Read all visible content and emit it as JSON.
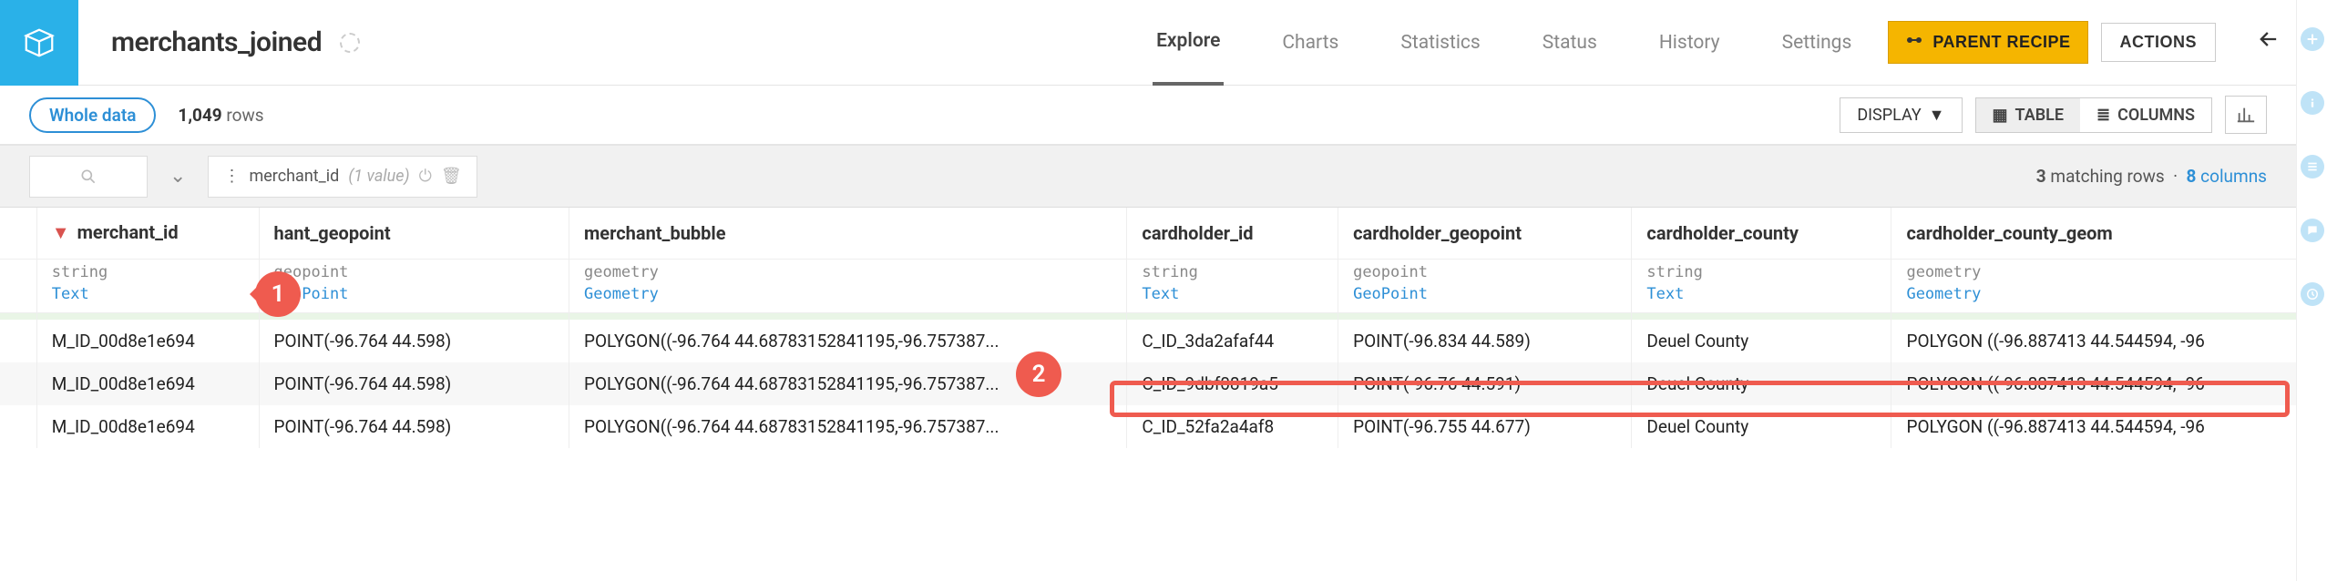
{
  "header": {
    "dataset_name": "merchants_joined",
    "tabs": [
      "Explore",
      "Charts",
      "Statistics",
      "Status",
      "History",
      "Settings"
    ],
    "active_tab": "Explore",
    "parent_recipe_label": "PARENT RECIPE",
    "actions_label": "ACTIONS"
  },
  "subbar": {
    "sample_label": "Whole data",
    "rows_count": "1,049",
    "rows_word": "rows",
    "display_label": "DISPLAY",
    "table_label": "TABLE",
    "columns_label": "COLUMNS"
  },
  "filter": {
    "chip_column": "merchant_id",
    "chip_value": "(1 value)",
    "matching_rows_count": "3",
    "matching_rows_label": "matching rows",
    "columns_count": "8",
    "columns_label": "columns"
  },
  "columns": [
    {
      "name": "merchant_id",
      "type": "string",
      "semantic": "Text",
      "filtered": true
    },
    {
      "name": "hant_geopoint",
      "full": "merchant_geopoint",
      "type": "geopoint",
      "semantic": "GeoPoint"
    },
    {
      "name": "merchant_bubble",
      "type": "geometry",
      "semantic": "Geometry"
    },
    {
      "name": "cardholder_id",
      "type": "string",
      "semantic": "Text"
    },
    {
      "name": "cardholder_geopoint",
      "type": "geopoint",
      "semantic": "GeoPoint"
    },
    {
      "name": "cardholder_county",
      "type": "string",
      "semantic": "Text"
    },
    {
      "name": "cardholder_county_geom",
      "type": "geometry",
      "semantic": "Geometry"
    }
  ],
  "rows": [
    {
      "merchant_id": "M_ID_00d8e1e694",
      "merchant_geopoint": "POINT(-96.764 44.598)",
      "merchant_bubble": "POLYGON((-96.764 44.68783152841195,-96.757387...",
      "cardholder_id": "C_ID_3da2afaf44",
      "cardholder_geopoint": "POINT(-96.834 44.589)",
      "cardholder_county": "Deuel County",
      "cardholder_county_geom": "POLYGON ((-96.887413 44.544594, -96"
    },
    {
      "merchant_id": "M_ID_00d8e1e694",
      "merchant_geopoint": "POINT(-96.764 44.598)",
      "merchant_bubble": "POLYGON((-96.764 44.68783152841195,-96.757387...",
      "cardholder_id": "C_ID_9dbf0819a5",
      "cardholder_geopoint": "POINT(-96.76 44.591)",
      "cardholder_county": "Deuel County",
      "cardholder_county_geom": "POLYGON ((-96.887413 44.544594, -96"
    },
    {
      "merchant_id": "M_ID_00d8e1e694",
      "merchant_geopoint": "POINT(-96.764 44.598)",
      "merchant_bubble": "POLYGON((-96.764 44.68783152841195,-96.757387...",
      "cardholder_id": "C_ID_52fa2a4af8",
      "cardholder_geopoint": "POINT(-96.755 44.677)",
      "cardholder_county": "Deuel County",
      "cardholder_county_geom": "POLYGON ((-96.887413 44.544594, -96"
    }
  ],
  "callouts": {
    "c1": "1",
    "c2": "2"
  }
}
